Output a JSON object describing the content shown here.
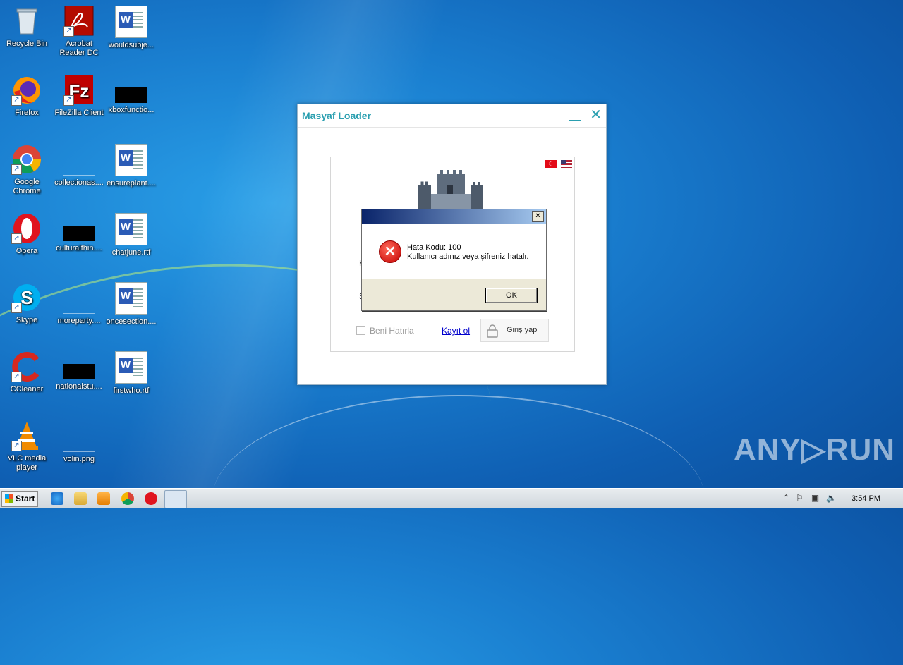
{
  "desktop": {
    "icons": [
      {
        "label": "Recycle Bin",
        "icon": "recycle-bin-icon"
      },
      {
        "label": "Acrobat Reader DC",
        "icon": "acrobat-reader-icon"
      },
      {
        "label": "wouldsubje...",
        "icon": "word-document-icon"
      },
      {
        "label": "Firefox",
        "icon": "firefox-icon"
      },
      {
        "label": "FileZilla Client",
        "icon": "filezilla-icon"
      },
      {
        "label": "xboxfunctio...",
        "icon": "redacted-file-icon"
      },
      {
        "label": "Google Chrome",
        "icon": "chrome-icon"
      },
      {
        "label": "collectionas....",
        "icon": "blank-file-icon"
      },
      {
        "label": "ensureplant....",
        "icon": "word-document-icon"
      },
      {
        "label": "Opera",
        "icon": "opera-icon"
      },
      {
        "label": "culturalthin....",
        "icon": "redacted-file-icon"
      },
      {
        "label": "chatjune.rtf",
        "icon": "word-document-icon"
      },
      {
        "label": "Skype",
        "icon": "skype-icon"
      },
      {
        "label": "moreparty....",
        "icon": "blank-file-icon"
      },
      {
        "label": "oncesection....",
        "icon": "word-document-icon"
      },
      {
        "label": "CCleaner",
        "icon": "ccleaner-icon"
      },
      {
        "label": "nationalstu....",
        "icon": "redacted-file-icon"
      },
      {
        "label": "firstwho.rtf",
        "icon": "word-document-icon"
      },
      {
        "label": "VLC media player",
        "icon": "vlc-icon"
      },
      {
        "label": "volin.png",
        "icon": "blank-file-icon"
      }
    ]
  },
  "loader_window": {
    "title": "Masyaf Loader",
    "remember_label": "Beni Hatırla",
    "register_link": "Kayıt ol",
    "login_button": "Giriş yap",
    "partial_k": "K",
    "partial_s": "Ş"
  },
  "error_dialog": {
    "close_label": "×",
    "line1": "Hata Kodu: 100",
    "line2": "Kullanıcı adınız veya şifreniz hatalı.",
    "ok_label": "OK"
  },
  "taskbar": {
    "start_label": "Start",
    "clock": "3:54 PM"
  },
  "watermark": "ANY▷RUN"
}
